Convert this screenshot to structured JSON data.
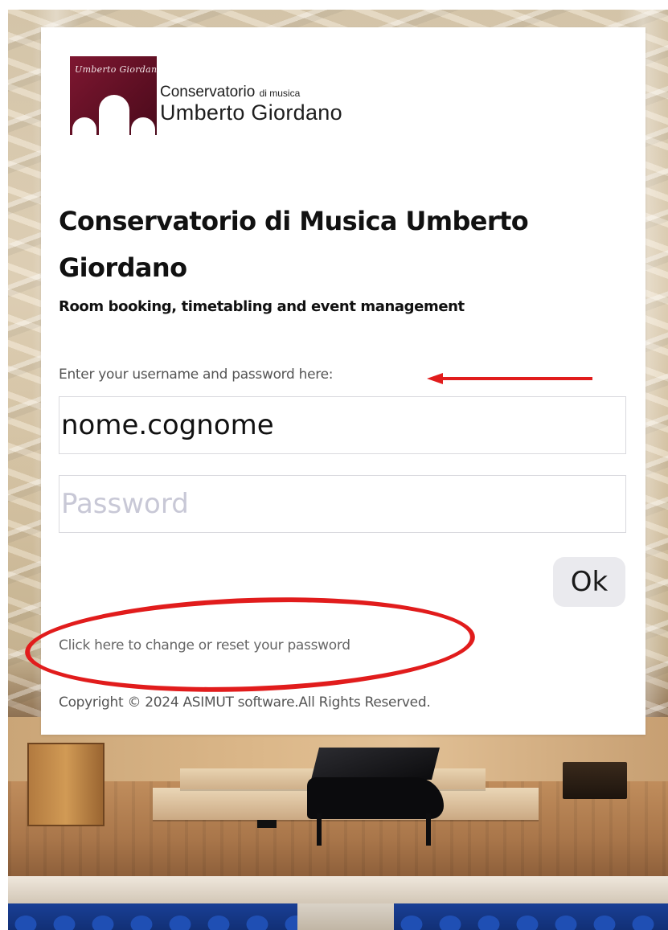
{
  "logo": {
    "signature": "Umberto Giordano",
    "line1_main": "Conservatorio",
    "line1_small": "di musica",
    "line2": "Umberto Giordano"
  },
  "heading": {
    "title": "Conservatorio di Musica Umberto Giordano",
    "subtitle": "Room booking, timetabling and event management"
  },
  "login": {
    "hint": "Enter your username and password here:",
    "username_value": "nome.cognome",
    "password_placeholder": "Password",
    "ok_label": "Ok",
    "reset_link": "Click here to change or reset your password"
  },
  "footer": {
    "copyright": "Copyright © 2024 ASIMUT software.All Rights Reserved."
  },
  "colors": {
    "brand": "#6e1329",
    "annotation": "#e11c1c"
  }
}
